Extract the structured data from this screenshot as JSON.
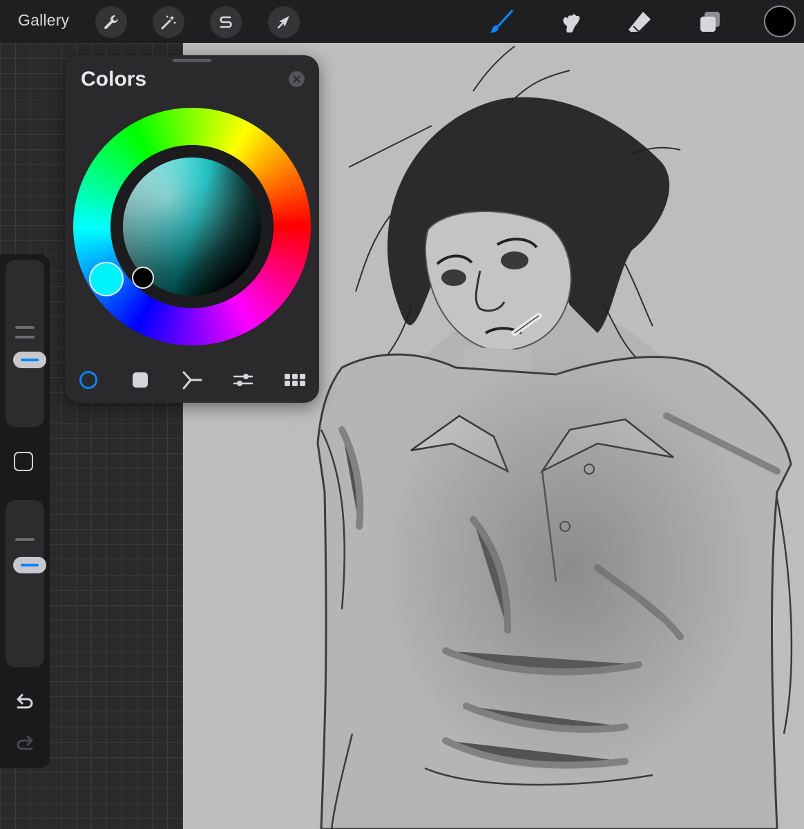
{
  "toolbar": {
    "gallery_label": "Gallery",
    "left_tools": [
      {
        "icon": "wrench-icon",
        "name": "actions"
      },
      {
        "icon": "magic-wand-icon",
        "name": "adjustments"
      },
      {
        "icon": "selection-s-icon",
        "name": "selection"
      },
      {
        "icon": "arrow-cursor-icon",
        "name": "transform"
      }
    ],
    "right_tools": [
      {
        "icon": "brush-icon",
        "name": "brush",
        "active": true
      },
      {
        "icon": "smudge-icon",
        "name": "smudge",
        "active": false
      },
      {
        "icon": "eraser-icon",
        "name": "eraser",
        "active": false
      },
      {
        "icon": "layers-icon",
        "name": "layers",
        "active": false
      }
    ],
    "current_color": "#000000",
    "accent_color": "#0a84ff"
  },
  "sidebar": {
    "brush_size_slider": {
      "icon": "size-slider"
    },
    "modify_button": {
      "icon": "square-icon"
    },
    "opacity_slider": {
      "icon": "opacity-slider"
    },
    "undo": {
      "icon": "undo-icon"
    },
    "redo": {
      "icon": "redo-icon"
    }
  },
  "colors_panel": {
    "title": "Colors",
    "hue_selector_color": "#00f2fa",
    "picked_color": "#000000",
    "tabs": [
      {
        "icon": "disc-icon",
        "name": "disc",
        "active": true
      },
      {
        "icon": "classic-square-icon",
        "name": "classic",
        "active": false
      },
      {
        "icon": "harmony-icon",
        "name": "harmony",
        "active": false
      },
      {
        "icon": "value-sliders-icon",
        "name": "value",
        "active": false
      },
      {
        "icon": "palettes-grid-icon",
        "name": "palettes",
        "active": false
      }
    ]
  },
  "canvas": {
    "artwork": "pencil-sketch-portrait"
  }
}
